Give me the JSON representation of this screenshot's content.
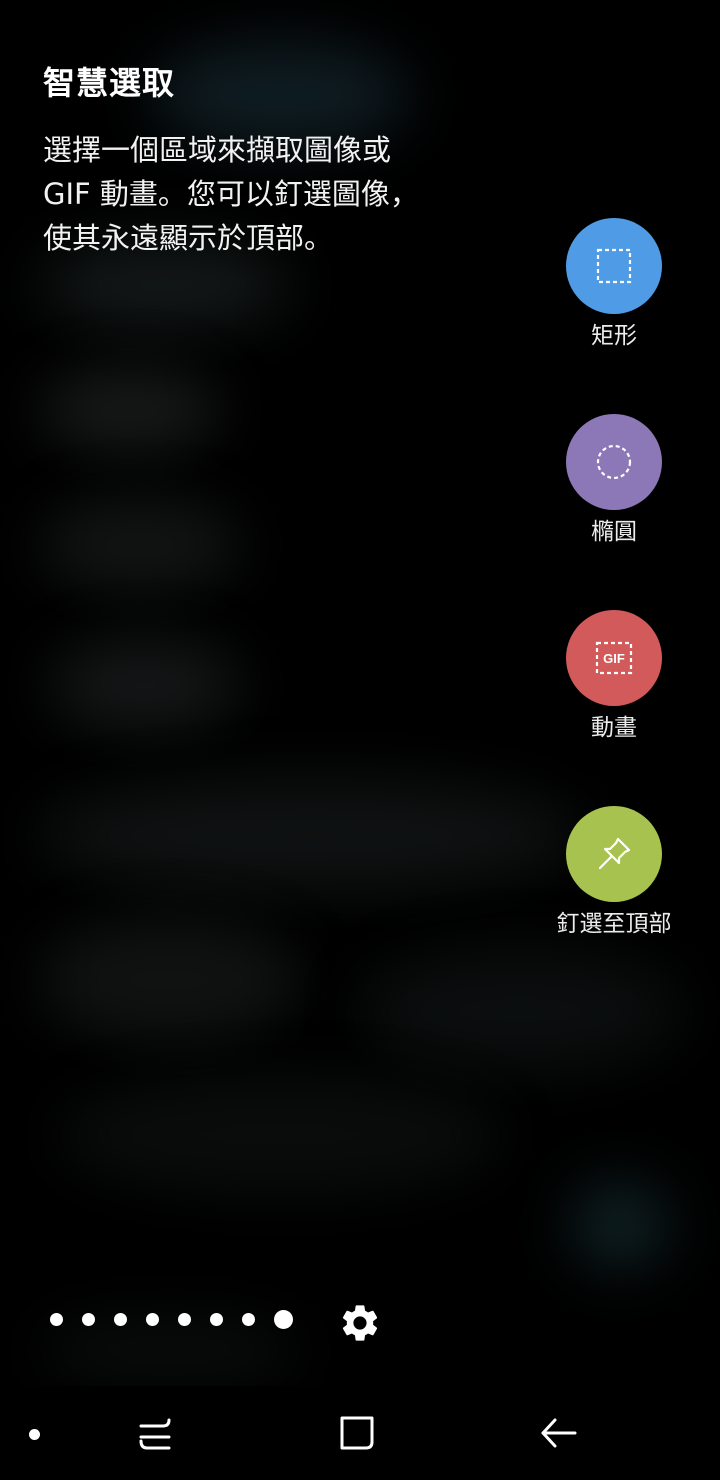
{
  "panel": {
    "title": "智慧選取",
    "description": "選擇一個區域來擷取圖像或 GIF 動畫。您可以釘選圖像，使其永遠顯示於頂部。"
  },
  "modes": [
    {
      "id": "rectangle",
      "label": "矩形",
      "icon": "rectangle-select-icon",
      "color": "#4f9be5"
    },
    {
      "id": "oval",
      "label": "橢圓",
      "icon": "oval-select-icon",
      "color": "#8c78b7"
    },
    {
      "id": "animation",
      "label": "動畫",
      "icon": "gif-select-icon",
      "icon_text": "GIF",
      "color": "#d35a5a"
    },
    {
      "id": "pin",
      "label": "釘選至頂部",
      "icon": "pin-icon",
      "color": "#a8c24f"
    }
  ],
  "pager": {
    "page_count": 8,
    "current_page": 8
  },
  "settings": {
    "icon": "gear-icon"
  },
  "navbar": {
    "items": [
      "menu-dot",
      "recent-apps-icon",
      "home-icon",
      "back-icon"
    ]
  }
}
